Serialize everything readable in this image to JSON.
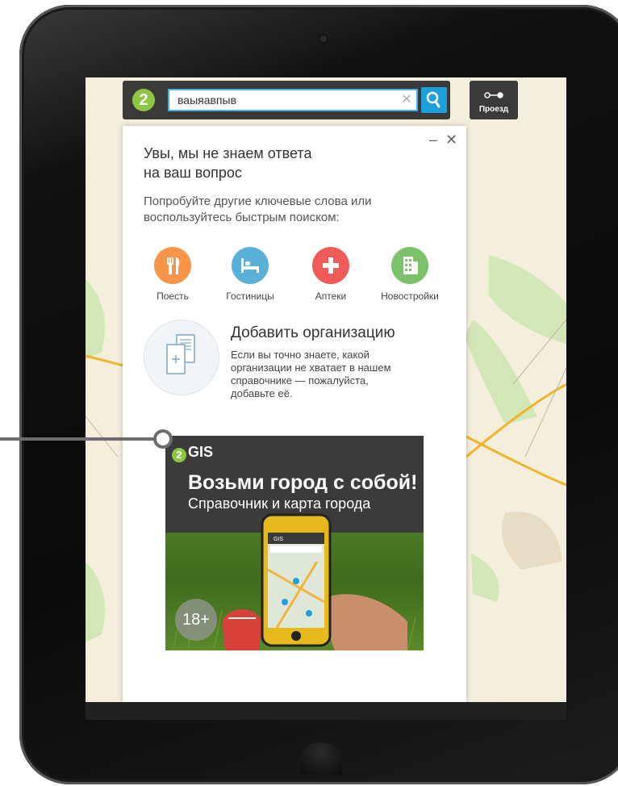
{
  "search": {
    "value": "ваыяавпыв",
    "logo_text": "2"
  },
  "route": {
    "label": "Проезд"
  },
  "panel": {
    "title_line1": "Увы, мы не знаем ответа",
    "title_line2": "на ваш вопрос",
    "subtitle_line1": "Попробуйте другие ключевые слова или",
    "subtitle_line2": "воспользуйтесь быстрым поиском:",
    "categories": [
      {
        "label": "Поесть",
        "icon": "fork-knife-icon",
        "color": "#f7964a"
      },
      {
        "label": "Гостиницы",
        "icon": "bed-icon",
        "color": "#5bb0d8"
      },
      {
        "label": "Аптеки",
        "icon": "cross-icon",
        "color": "#ef5b58"
      },
      {
        "label": "Новостройки",
        "icon": "building-icon",
        "color": "#7cc26b"
      }
    ],
    "add_org": {
      "title": "Добавить организацию",
      "text_line1": "Если вы точно знаете, какой",
      "text_line2": "организации не хватает в нашем",
      "text_line3": "справочнике — пожалуйста,",
      "text_line4": "добавьте её."
    }
  },
  "ad": {
    "logo": "GIS",
    "logo_mark": "2",
    "headline": "Возьми город с собой!",
    "subheadline": "Справочник и карта города",
    "age": "18+",
    "phone_logo": "GIS"
  },
  "colors": {
    "accent": "#1ea0dc",
    "brand_green": "#8dc63f",
    "topbar": "#3a3a3a"
  }
}
